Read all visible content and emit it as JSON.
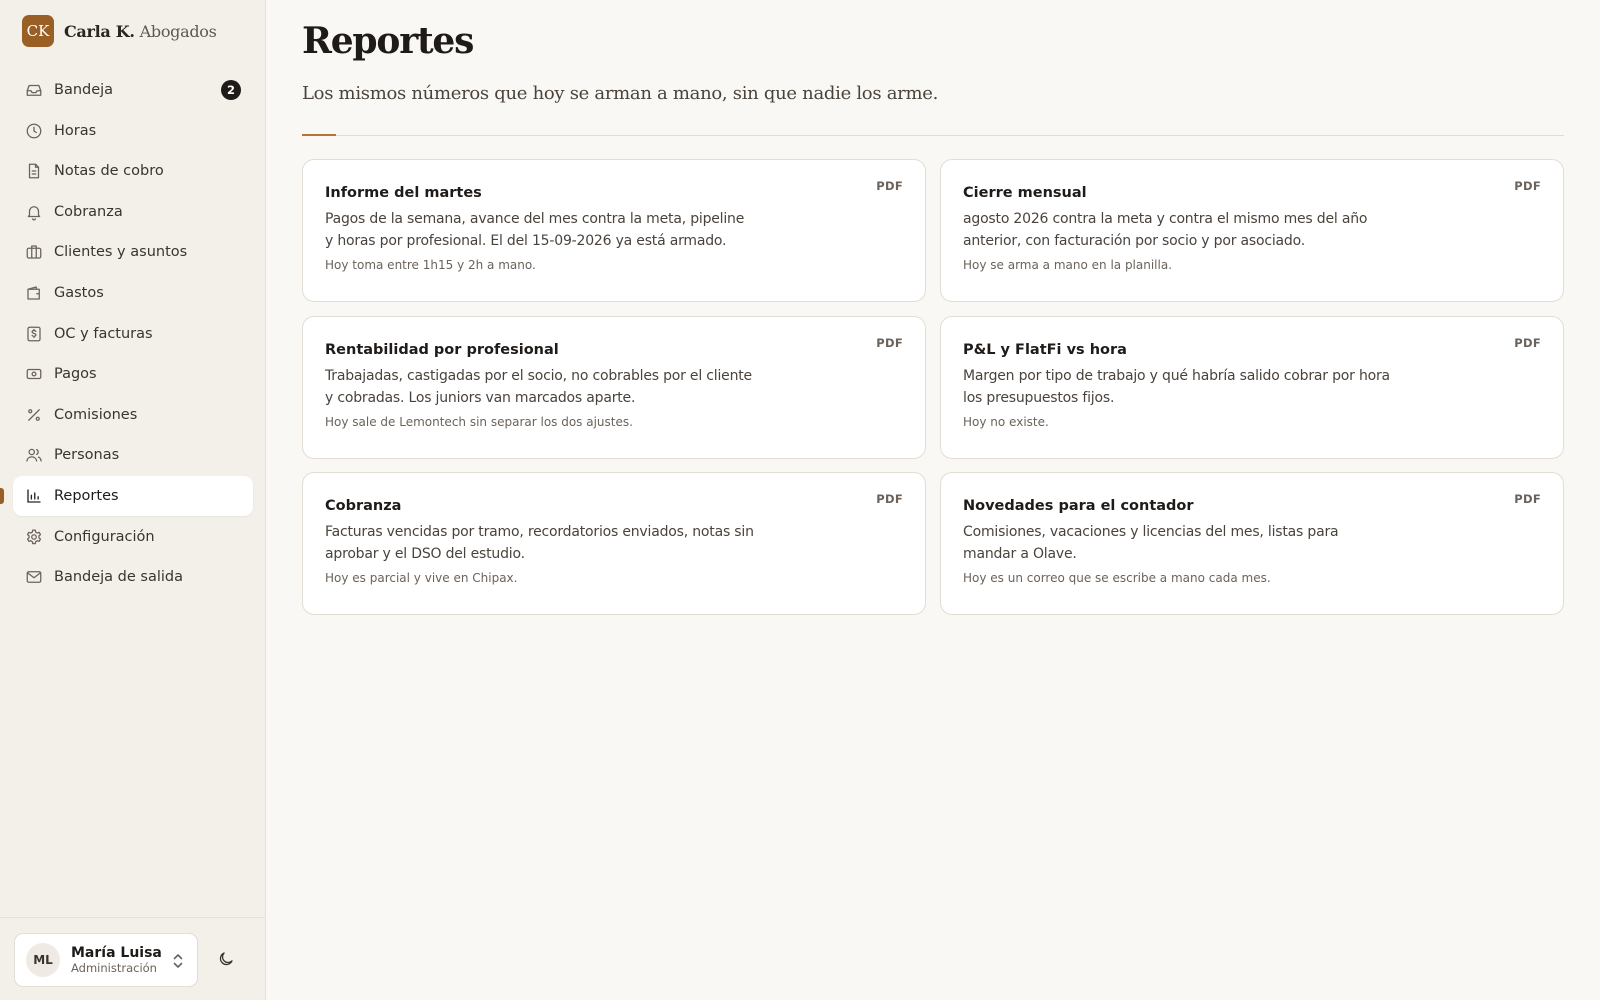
{
  "brand": {
    "mark": "CK",
    "name": "Carla K.",
    "suffix": "Abogados"
  },
  "sidebar": {
    "items": [
      {
        "label": "Bandeja",
        "icon": "inbox-icon",
        "badge": "2"
      },
      {
        "label": "Horas",
        "icon": "clock-icon"
      },
      {
        "label": "Notas de cobro",
        "icon": "document-icon"
      },
      {
        "label": "Cobranza",
        "icon": "bell-icon"
      },
      {
        "label": "Clientes y asuntos",
        "icon": "briefcase-icon"
      },
      {
        "label": "Gastos",
        "icon": "wallet-icon"
      },
      {
        "label": "OC y facturas",
        "icon": "dollar-receipt-icon"
      },
      {
        "label": "Pagos",
        "icon": "banknote-icon"
      },
      {
        "label": "Comisiones",
        "icon": "percent-icon"
      },
      {
        "label": "Personas",
        "icon": "users-icon"
      },
      {
        "label": "Reportes",
        "icon": "bar-chart-icon",
        "active": true
      },
      {
        "label": "Configuración",
        "icon": "gear-icon"
      },
      {
        "label": "Bandeja de salida",
        "icon": "mail-icon"
      }
    ]
  },
  "user": {
    "initials": "ML",
    "name": "María Luisa",
    "role": "Administración"
  },
  "page": {
    "title": "Reportes",
    "subtitle": "Los mismos números que hoy se arman a mano, sin que nadie los arme."
  },
  "reports": [
    {
      "title": "Informe del martes",
      "desc": "Pagos de la semana, avance del mes contra la meta, pipeline y horas por profesional. El del 15-09-2026 ya está armado.",
      "note": "Hoy toma entre 1h15 y 2h a mano.",
      "tag": "PDF"
    },
    {
      "title": "Cierre mensual",
      "desc": "agosto 2026 contra la meta y contra el mismo mes del año anterior, con facturación por socio y por asociado.",
      "note": "Hoy se arma a mano en la planilla.",
      "tag": "PDF"
    },
    {
      "title": "Rentabilidad por profesional",
      "desc": "Trabajadas, castigadas por el socio, no cobrables por el cliente y cobradas. Los juniors van marcados aparte.",
      "note": "Hoy sale de Lemontech sin separar los dos ajustes.",
      "tag": "PDF"
    },
    {
      "title": "P&L y FlatFi vs hora",
      "desc": "Margen por tipo de trabajo y qué habría salido cobrar por hora los presupuestos fijos.",
      "note": "Hoy no existe.",
      "tag": "PDF"
    },
    {
      "title": "Cobranza",
      "desc": "Facturas vencidas por tramo, recordatorios enviados, notas sin aprobar y el DSO del estudio.",
      "note": "Hoy es parcial y vive en Chipax.",
      "tag": "PDF"
    },
    {
      "title": "Novedades para el contador",
      "desc": "Comisiones, vacaciones y licencias del mes, listas para mandar a Olave.",
      "note": "Hoy es un correo que se escribe a mano cada mes.",
      "tag": "PDF"
    }
  ]
}
